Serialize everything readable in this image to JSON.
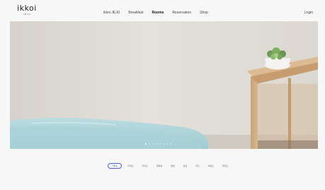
{
  "brand": {
    "name": "ikkoi",
    "sub": "JEJU"
  },
  "nav": {
    "items": [
      "ikkoi JEJU",
      "Breakfast",
      "Rooms",
      "Reservation",
      "Shop"
    ],
    "active": "Rooms",
    "login_label": "Login"
  },
  "hero": {
    "slides_total": 1,
    "active_slide": 1
  },
  "rooms": {
    "tabs": [
      "가파도",
      "마라도",
      "차귀도",
      "형제섬",
      "범섬",
      "섶섬",
      "우도",
      "비양도",
      "제주도"
    ],
    "active_tab": "가파도"
  },
  "colors": {
    "accent": "#4a63c6",
    "background": "#f7f7f7"
  }
}
